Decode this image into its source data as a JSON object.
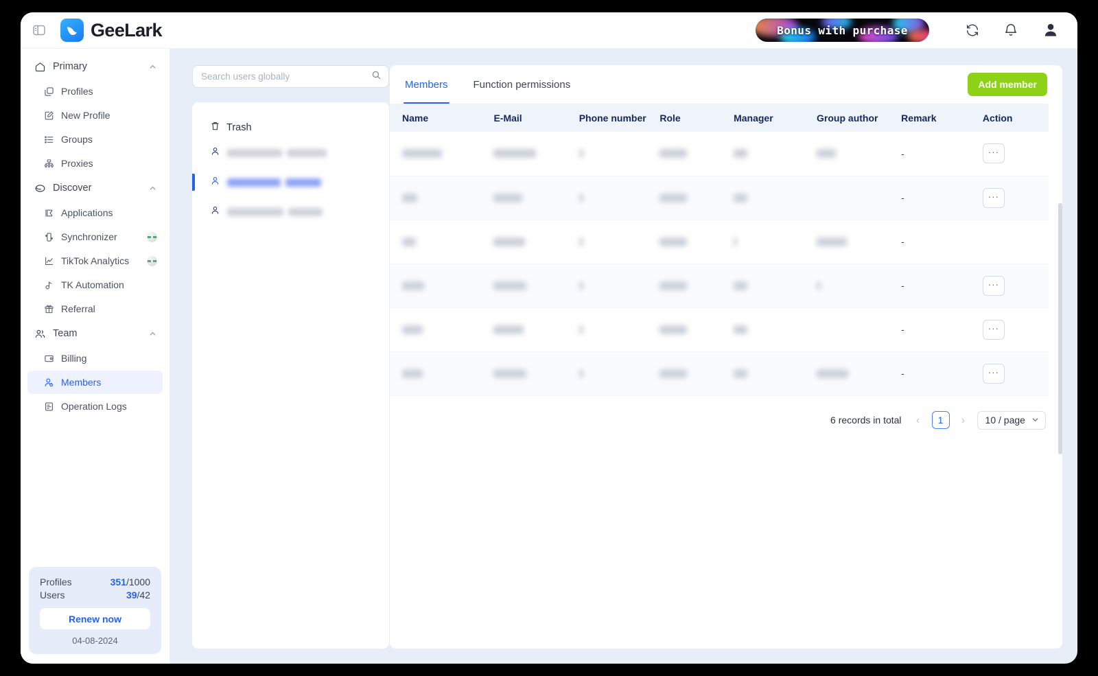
{
  "topbar": {
    "panel_toggle_icon": "panel-toggle-icon",
    "brand_name": "GeeLark",
    "promo_text": "Bonus with purchase",
    "refresh_icon": "refresh-icon",
    "bell_icon": "bell-icon",
    "avatar_icon": "user-avatar-icon"
  },
  "sidebar": {
    "groups": [
      {
        "label": "Primary",
        "icon": "home-icon",
        "expanded": true,
        "items": [
          {
            "label": "Profiles",
            "icon": "profiles-icon",
            "active": false,
            "badge": false
          },
          {
            "label": "New Profile",
            "icon": "new-profile-icon",
            "active": false,
            "badge": false
          },
          {
            "label": "Groups",
            "icon": "list-icon",
            "active": false,
            "badge": false
          },
          {
            "label": "Proxies",
            "icon": "proxies-icon",
            "active": false,
            "badge": false
          }
        ]
      },
      {
        "label": "Discover",
        "icon": "discover-icon",
        "expanded": true,
        "items": [
          {
            "label": "Applications",
            "icon": "applications-icon",
            "active": false,
            "badge": false
          },
          {
            "label": "Synchronizer",
            "icon": "synchronizer-icon",
            "active": false,
            "badge": true
          },
          {
            "label": "TikTok Analytics",
            "icon": "analytics-chart-icon",
            "active": false,
            "badge": true
          },
          {
            "label": "TK Automation",
            "icon": "tiktok-note-icon",
            "active": false,
            "badge": false
          },
          {
            "label": "Referral",
            "icon": "gift-icon",
            "active": false,
            "badge": false
          }
        ]
      },
      {
        "label": "Team",
        "icon": "team-people-icon",
        "expanded": true,
        "items": [
          {
            "label": "Billing",
            "icon": "billing-card-icon",
            "active": false,
            "badge": false
          },
          {
            "label": "Members",
            "icon": "member-person-icon",
            "active": true,
            "badge": false
          },
          {
            "label": "Operation Logs",
            "icon": "logs-document-icon",
            "active": false,
            "badge": false
          }
        ]
      }
    ],
    "quota": {
      "profiles_label": "Profiles",
      "profiles_used": "351",
      "profiles_total": "/1000",
      "users_label": "Users",
      "users_used": "39",
      "users_total": "/42",
      "renew_label": "Renew now",
      "date": "04-08-2024"
    }
  },
  "search": {
    "placeholder": "Search users globally",
    "value": "",
    "icon": "search-icon"
  },
  "users_pane": {
    "trash_label": "Trash",
    "trash_icon": "trash-icon",
    "items": [
      {
        "icon": "person-icon",
        "selected": false,
        "w1": 80,
        "w2": 58
      },
      {
        "icon": "person-icon",
        "selected": true,
        "w1": 78,
        "w2": 52
      },
      {
        "icon": "person-icon",
        "selected": false,
        "w1": 82,
        "w2": 50
      }
    ]
  },
  "content": {
    "tabs": [
      {
        "label": "Members",
        "active": true
      },
      {
        "label": "Function permissions",
        "active": false
      }
    ],
    "add_member_label": "Add member",
    "table": {
      "columns": [
        "Name",
        "E-Mail",
        "Phone number",
        "Role",
        "Manager",
        "Group author",
        "Remark",
        "Action"
      ],
      "rows": [
        {
          "name_w": 58,
          "email_w": 62,
          "phone_w": 6,
          "role_w": 40,
          "manager_w": 20,
          "group_w": 28,
          "remark": "-",
          "has_action": true
        },
        {
          "name_w": 22,
          "email_w": 42,
          "phone_w": 6,
          "role_w": 40,
          "manager_w": 20,
          "group_w": 0,
          "remark": "-",
          "has_action": true
        },
        {
          "name_w": 20,
          "email_w": 46,
          "phone_w": 6,
          "role_w": 40,
          "manager_w": 5,
          "group_w": 44,
          "remark": "-",
          "has_action": false
        },
        {
          "name_w": 32,
          "email_w": 48,
          "phone_w": 6,
          "role_w": 40,
          "manager_w": 20,
          "group_w": 6,
          "remark": "-",
          "has_action": true
        },
        {
          "name_w": 30,
          "email_w": 44,
          "phone_w": 6,
          "role_w": 40,
          "manager_w": 20,
          "group_w": 0,
          "remark": "-",
          "has_action": true
        },
        {
          "name_w": 30,
          "email_w": 48,
          "phone_w": 6,
          "role_w": 40,
          "manager_w": 20,
          "group_w": 46,
          "remark": "-",
          "has_action": true
        }
      ],
      "action_glyph": "···"
    },
    "pagination": {
      "records_total": "6 records in total",
      "prev_glyph": "‹",
      "page": "1",
      "next_glyph": "›",
      "page_size": "10 / page",
      "chevron": "chevron-down-icon"
    }
  },
  "colors": {
    "accent_blue": "#2563eb",
    "add_button_green": "#8ed217",
    "page_bg": "#e8eef7",
    "table_header_bg": "#eff3fa"
  }
}
